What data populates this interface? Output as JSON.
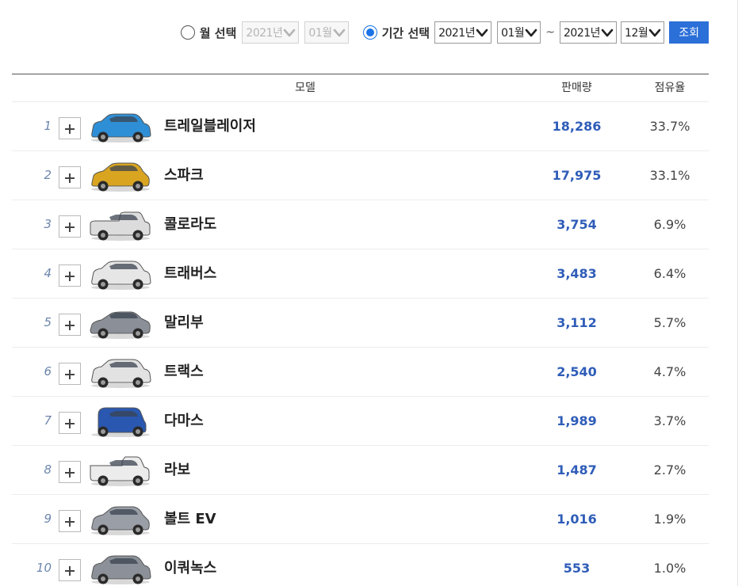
{
  "filter": {
    "month_option": {
      "label": "월 선택",
      "year": "2021년",
      "month": "01월",
      "selected": false
    },
    "period_option": {
      "label": "기간 선택",
      "start_year": "2021년",
      "start_month": "01월",
      "separator": "~",
      "end_year": "2021년",
      "end_month": "12월",
      "selected": true
    },
    "search_button": "조회"
  },
  "table": {
    "headers": {
      "model": "모델",
      "sales": "판매량",
      "share": "점유율"
    },
    "rows": [
      {
        "rank": "1",
        "name": "트레일블레이저",
        "sales": "18,286",
        "share": "33.7%",
        "car_icon": "suv-icon",
        "color": "#2f8fd6"
      },
      {
        "rank": "2",
        "name": "스파크",
        "sales": "17,975",
        "share": "33.1%",
        "car_icon": "hatchback-icon",
        "color": "#d9a521"
      },
      {
        "rank": "3",
        "name": "콜로라도",
        "sales": "3,754",
        "share": "6.9%",
        "car_icon": "pickup-icon",
        "color": "#dcdcdc"
      },
      {
        "rank": "4",
        "name": "트래버스",
        "sales": "3,483",
        "share": "6.4%",
        "car_icon": "suv-icon",
        "color": "#e6e6e6"
      },
      {
        "rank": "5",
        "name": "말리부",
        "sales": "3,112",
        "share": "5.7%",
        "car_icon": "sedan-icon",
        "color": "#8a8f98"
      },
      {
        "rank": "6",
        "name": "트랙스",
        "sales": "2,540",
        "share": "4.7%",
        "car_icon": "suv-icon",
        "color": "#e2e2e2"
      },
      {
        "rank": "7",
        "name": "다마스",
        "sales": "1,989",
        "share": "3.7%",
        "car_icon": "van-icon",
        "color": "#2a58b0"
      },
      {
        "rank": "8",
        "name": "라보",
        "sales": "1,487",
        "share": "2.7%",
        "car_icon": "truck-icon",
        "color": "#ececec"
      },
      {
        "rank": "9",
        "name": "볼트 EV",
        "sales": "1,016",
        "share": "1.9%",
        "car_icon": "hatchback-icon",
        "color": "#9a9ea6"
      },
      {
        "rank": "10",
        "name": "이쿼녹스",
        "sales": "553",
        "share": "1.0%",
        "car_icon": "suv-icon",
        "color": "#8c9098"
      }
    ]
  },
  "colors": {
    "accent": "#1a73e8",
    "button": "#2b6fd8",
    "sales_text": "#2f5db8",
    "rank_text": "#6d86ad"
  }
}
